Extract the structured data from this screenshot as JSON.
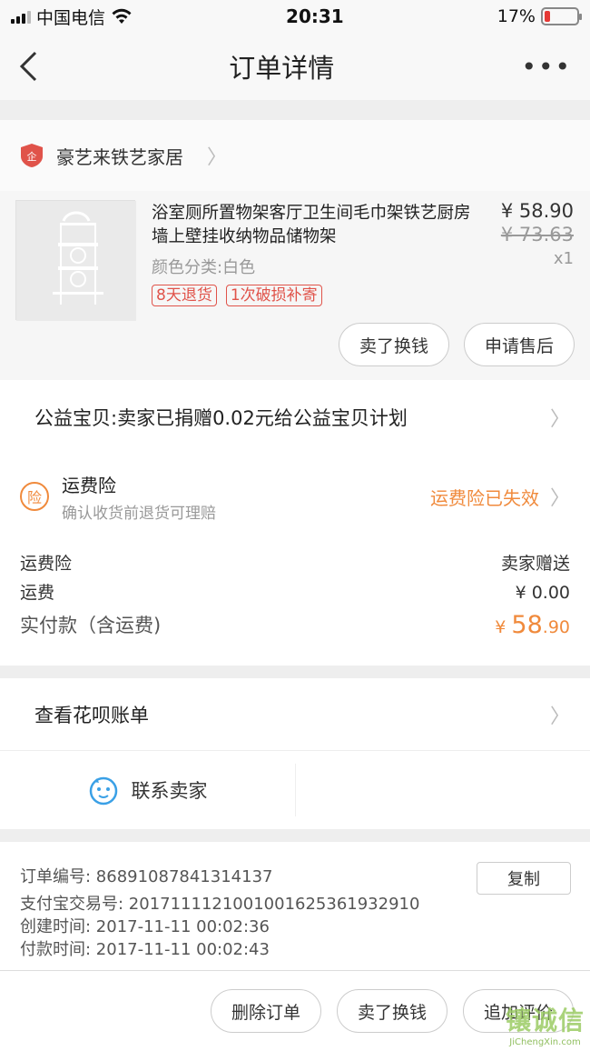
{
  "status_bar": {
    "carrier": "中国电信",
    "time": "20:31",
    "battery": "17%",
    "battery_level": 0.17
  },
  "nav": {
    "title": "订单详情"
  },
  "shop": {
    "name": "豪艺来铁艺家居"
  },
  "product": {
    "title": "浴室厕所置物架客厅卫生间毛巾架铁艺厨房墙上壁挂收纳物品储物架",
    "sku": "颜色分类:白色",
    "price": "¥ 58.90",
    "original_price": "¥ 73.63",
    "qty": "x1",
    "tags": [
      "8天退货",
      "1次破损补寄"
    ]
  },
  "product_actions": [
    "卖了换钱",
    "申请售后"
  ],
  "charity": {
    "text": "公益宝贝:卖家已捐赠0.02元给公益宝贝计划"
  },
  "insurance": {
    "icon_char": "险",
    "title": "运费险",
    "subtitle": "确认收货前退货可理赔",
    "status": "运费险已失效"
  },
  "fees": {
    "rows": [
      {
        "label": "运费险",
        "value": "卖家赠送"
      },
      {
        "label": "运费",
        "value": "¥ 0.00"
      }
    ],
    "total_label": "实付款（含运费)",
    "total_currency": "¥ ",
    "total_int": "58",
    "total_dec": ".90"
  },
  "huabei": {
    "label": "查看花呗账单"
  },
  "contact": {
    "label": "联系卖家"
  },
  "order_info": {
    "order_no": "订单编号:   86891087841314137",
    "alipay_no": "支付宝交易号:   2017111121001001625361932910",
    "created": "创建时间:   2017-11-11 00:02:36",
    "paid": "付款时间:   2017-11-11 00:02:43",
    "copy_label": "复制"
  },
  "bottom_actions": [
    "删除订单",
    "卖了换钱",
    "追加评价"
  ],
  "watermark": {
    "main": "镶诚信",
    "sub": "JiChengXin.com"
  },
  "colors": {
    "accent": "#f08a3c",
    "tag": "#e0534a"
  }
}
